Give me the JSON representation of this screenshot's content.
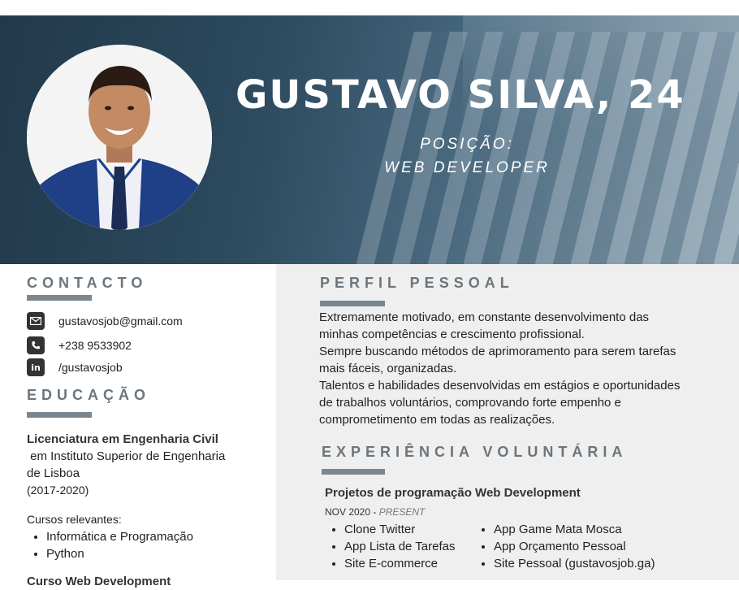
{
  "header": {
    "name": "GUSTAVO SILVA, 24",
    "position_label": "POSIÇÃO:",
    "position_value": "WEB DEVELOPER"
  },
  "contact": {
    "title": "CONTACTO",
    "items": [
      {
        "icon": "email-icon",
        "text": "gustavosjob@gmail.com"
      },
      {
        "icon": "phone-icon",
        "text": "+238 9533902"
      },
      {
        "icon": "linkedin-icon",
        "text": "/gustavosjob"
      }
    ]
  },
  "education": {
    "title": "EDUCAÇÃO",
    "degree": "Licenciatura em Engenharia Civil",
    "institution_line1": " em Instituto Superior de Engenharia",
    "institution_line2": "de Lisboa",
    "period": "(2017-2020)",
    "courses_title": "Cursos relevantes:",
    "courses": [
      "Informática e Programação",
      "Python"
    ],
    "next_item_cut": "Curso Web Development"
  },
  "profile": {
    "title": "PERFIL PESSOAL",
    "lines": [
      "Extremamente motivado, em constante desenvolvimento das",
      "minhas competências e crescimento profissional.",
      "Sempre buscando métodos de aprimoramento para serem tarefas",
      "mais fáceis, organizadas.",
      "Talentos e habilidades desenvolvidas em estágios e oportunidades",
      "de trabalhos voluntários, comprovando forte empenho e",
      "comprometimento em todas as realizações."
    ]
  },
  "volunteer": {
    "title": "EXPERIÊNCIA VOLUNTÁRIA",
    "project_title": "Projetos de programação Web Development",
    "date_start": "NOV 2020 - ",
    "date_end": "PRESENT",
    "col1": [
      "Clone Twitter",
      "App Lista de Tarefas",
      "Site E-commerce"
    ],
    "col2": [
      "App Game Mata Mosca",
      "App Orçamento Pessoal",
      "Site Pessoal (gustavosjob.ga)"
    ]
  },
  "colors": {
    "header_dark": "#21394b",
    "section_title": "#6b757c",
    "accent_bar": "#7b8790",
    "right_panel_bg": "#efefef"
  }
}
